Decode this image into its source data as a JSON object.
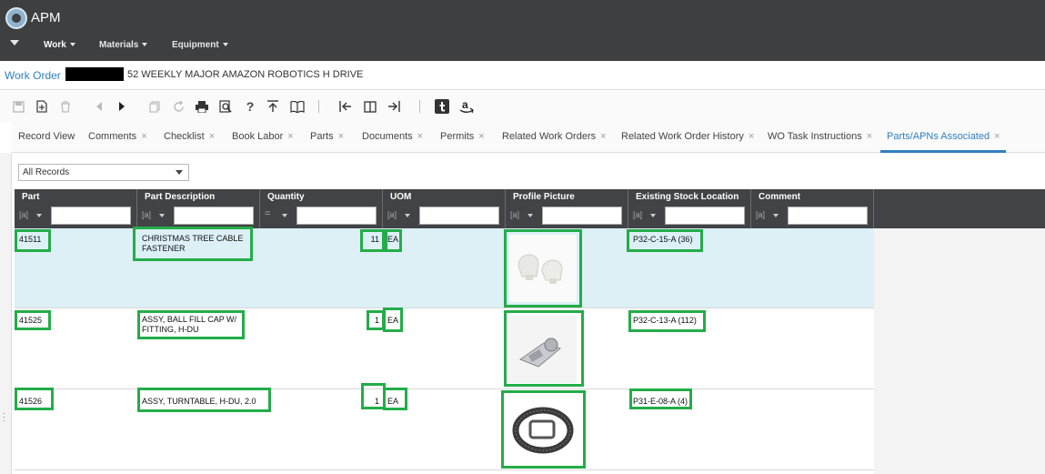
{
  "app": {
    "title": "APM"
  },
  "nav": {
    "items": [
      "Work",
      "Materials",
      "Equipment"
    ]
  },
  "breadcrumb": {
    "link": "Work Order",
    "title": "52 WEEKLY MAJOR AMAZON ROBOTICS H DRIVE"
  },
  "toolbar": {
    "icons": [
      "save-icon",
      "new-record-icon",
      "delete-icon",
      "previous-icon",
      "next-icon",
      "copy-icon",
      "refresh-icon",
      "print-icon",
      "preview-icon",
      "help-icon",
      "share-icon",
      "book-icon",
      "first-page-icon",
      "split-view-icon",
      "last-page-icon",
      "tumblr-icon",
      "amazon-icon"
    ],
    "help_glyph": "?"
  },
  "tabs": [
    {
      "label": "Record View",
      "closable": false
    },
    {
      "label": "Comments",
      "closable": true
    },
    {
      "label": "Checklist",
      "closable": true
    },
    {
      "label": "Book Labor",
      "closable": true
    },
    {
      "label": "Parts",
      "closable": true
    },
    {
      "label": "Documents",
      "closable": true
    },
    {
      "label": "Permits",
      "closable": true
    },
    {
      "label": "Related Work Orders",
      "closable": true
    },
    {
      "label": "Related Work Order History",
      "closable": true
    },
    {
      "label": "WO Task Instructions",
      "closable": true
    },
    {
      "label": "Parts/APNs Associated",
      "closable": true,
      "active": true
    }
  ],
  "tab_close_glyph": "×",
  "filter": {
    "selected": "All Records"
  },
  "grid": {
    "columns": [
      "Part",
      "Part Description",
      "Quantity",
      "UOM",
      "Profile Picture",
      "Existing Stock Location",
      "Comment"
    ],
    "filter_glyphs": [
      "[a]",
      "[a]",
      "=",
      "[a]",
      "[a]",
      "[a]",
      "[a]"
    ],
    "rows": [
      {
        "part": "41511",
        "description": "CHRISTMAS TREE CABLE FASTENER",
        "quantity": "11",
        "uom": "EA",
        "picture": "cable-fastener-photo",
        "location": "P32-C-15-A (36)",
        "comment": ""
      },
      {
        "part": "41525",
        "description": "ASSY, BALL FILL CAP W/ FITTING, H-DU",
        "quantity": "1",
        "uom": "EA",
        "picture": "ball-fill-cap-photo",
        "location": "P32-C-13-A (112)",
        "comment": ""
      },
      {
        "part": "41526",
        "description": "ASSY, TURNTABLE, H-DU, 2.0",
        "quantity": "1",
        "uom": "EA",
        "picture": "turntable-photo",
        "location": "P31-E-08-A (4)",
        "comment": ""
      }
    ]
  },
  "colors": {
    "topbar": "#3d3f41",
    "accent": "#2f7fc1",
    "selected_row": "#dcf0f6",
    "highlight_box": "#23ad48"
  }
}
